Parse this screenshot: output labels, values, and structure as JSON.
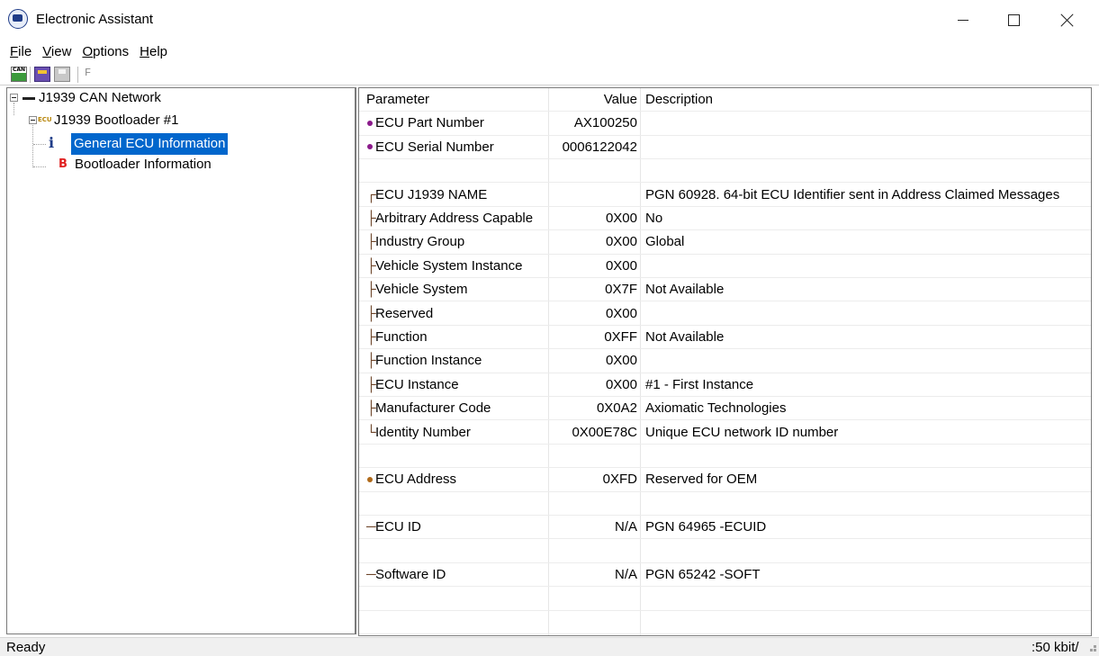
{
  "window": {
    "title": "Electronic Assistant"
  },
  "menu": {
    "items": [
      {
        "label": "File",
        "accel": "F",
        "rest": "ile"
      },
      {
        "label": "View",
        "accel": "V",
        "rest": "iew"
      },
      {
        "label": "Options",
        "accel": "O",
        "rest": "ptions"
      },
      {
        "label": "Help",
        "accel": "H",
        "rest": "elp"
      }
    ]
  },
  "toolbar": {
    "buttons": [
      "can-network-icon",
      "program-ecu-icon",
      "save-icon"
    ],
    "disabled_label": "F"
  },
  "tree": {
    "root": {
      "label": "J1939 CAN Network",
      "icon": "network-icon"
    },
    "ecu": {
      "label": "J1939 Bootloader #1",
      "icon": "ecu-icon",
      "icon_text": "ECU"
    },
    "items": [
      {
        "label": "General ECU Information",
        "icon": "info-icon",
        "icon_text": "i",
        "selected": true
      },
      {
        "label": "Bootloader Information",
        "icon": "bootloader-icon",
        "icon_text": "B",
        "selected": false
      }
    ]
  },
  "grid": {
    "headers": {
      "parameter": "Parameter",
      "value": "Value",
      "description": "Description"
    },
    "rows": [
      {
        "parameter": "ECU Part Number",
        "marker": "dot",
        "marker_color": "#8b1a8b",
        "value": "AX100250",
        "description": ""
      },
      {
        "parameter": "ECU Serial Number",
        "marker": "dot",
        "marker_color": "#8b1a8b",
        "value": "0006122042",
        "description": ""
      },
      {
        "parameter": "",
        "marker": "",
        "value": "",
        "description": ""
      },
      {
        "parameter": "ECU J1939 NAME",
        "marker": "┌",
        "value": "",
        "description": "PGN 60928. 64-bit ECU Identifier sent in Address Claimed Messages"
      },
      {
        "parameter": "Arbitrary Address Capable",
        "marker": "├",
        "value": "0X00",
        "description": "No"
      },
      {
        "parameter": "Industry Group",
        "marker": "├",
        "value": "0X00",
        "description": "Global"
      },
      {
        "parameter": "Vehicle System Instance",
        "marker": "├",
        "value": "0X00",
        "description": ""
      },
      {
        "parameter": "Vehicle System",
        "marker": "├",
        "value": "0X7F",
        "description": "Not Available"
      },
      {
        "parameter": "Reserved",
        "marker": "├",
        "value": "0X00",
        "description": ""
      },
      {
        "parameter": "Function",
        "marker": "├",
        "value": "0XFF",
        "description": "Not Available"
      },
      {
        "parameter": "Function Instance",
        "marker": "├",
        "value": "0X00",
        "description": ""
      },
      {
        "parameter": "ECU Instance",
        "marker": "├",
        "value": "0X00",
        "description": "#1 - First Instance"
      },
      {
        "parameter": "Manufacturer Code",
        "marker": "├",
        "value": "0X0A2",
        "description": "Axiomatic Technologies"
      },
      {
        "parameter": "Identity Number",
        "marker": "└",
        "value": "0X00E78C",
        "description": "Unique ECU network ID number"
      },
      {
        "parameter": "",
        "marker": "",
        "value": "",
        "description": ""
      },
      {
        "parameter": "ECU Address",
        "marker": "dot",
        "marker_color": "#b06a1a",
        "value": "0XFD",
        "description": "Reserved for OEM"
      },
      {
        "parameter": "",
        "marker": "",
        "value": "",
        "description": ""
      },
      {
        "parameter": "ECU ID",
        "marker": "─",
        "value": "N/A",
        "description": "PGN 64965   -ECUID"
      },
      {
        "parameter": "",
        "marker": "",
        "value": "",
        "description": ""
      },
      {
        "parameter": "Software ID",
        "marker": "─",
        "value": "N/A",
        "description": "PGN 65242   -SOFT"
      },
      {
        "parameter": "",
        "marker": "",
        "value": "",
        "description": ""
      },
      {
        "parameter": "",
        "marker": "",
        "value": "",
        "description": ""
      }
    ]
  },
  "status": {
    "text": "Ready",
    "rate": ":50 kbit/"
  }
}
